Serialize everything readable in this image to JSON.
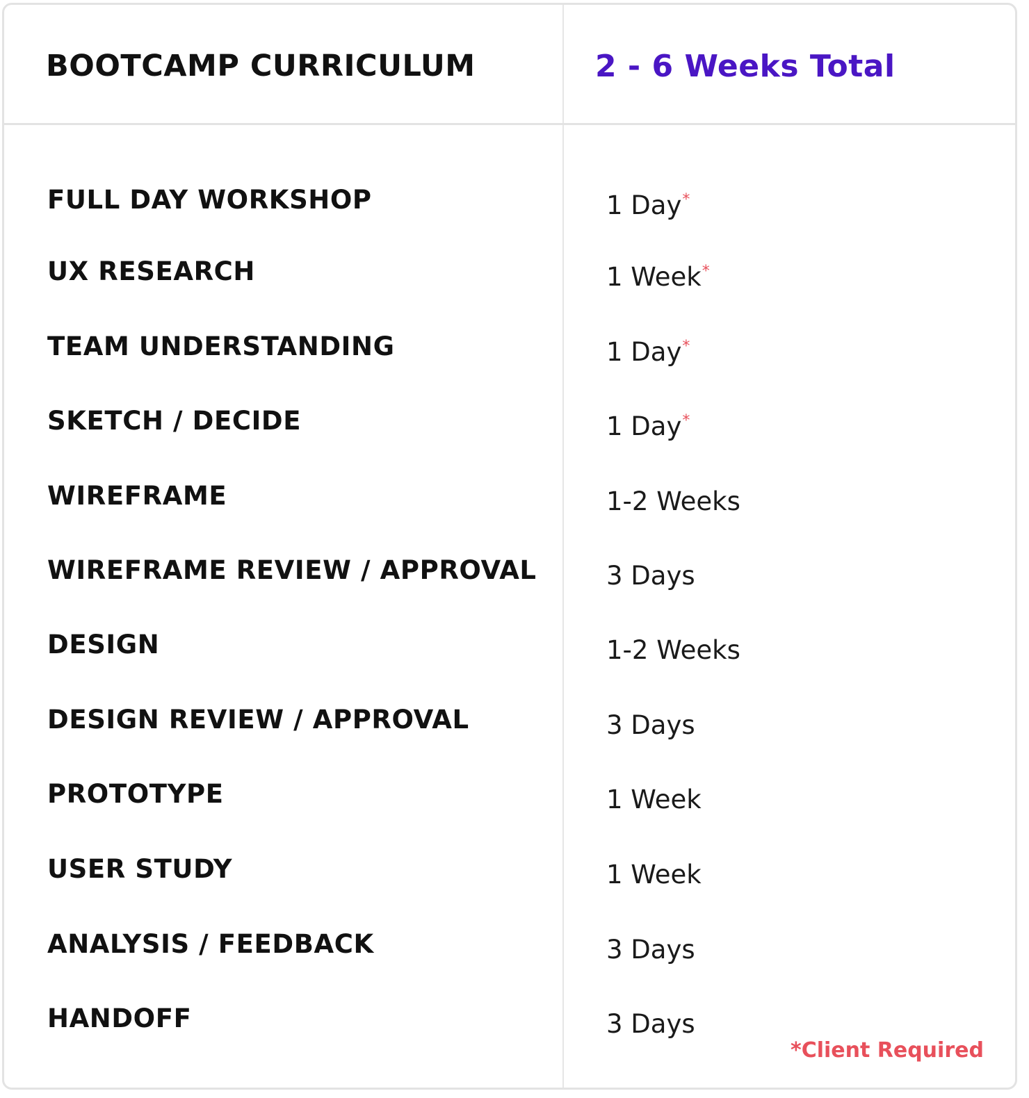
{
  "header": {
    "title": "BOOTCAMP CURRICULUM",
    "total": "2 - 6 Weeks Total"
  },
  "rows": [
    {
      "stage": "FULL DAY WORKSHOP",
      "duration": "1 Day",
      "required_mark": "*"
    },
    {
      "stage": "UX RESEARCH",
      "duration": "1 Week",
      "required_mark": "*"
    },
    {
      "stage": "TEAM UNDERSTANDING",
      "duration": "1 Day",
      "required_mark": "*"
    },
    {
      "stage": "SKETCH / DECIDE",
      "duration": "1 Day",
      "required_mark": "*"
    },
    {
      "stage": "WIREFRAME",
      "duration": "1-2 Weeks",
      "required_mark": ""
    },
    {
      "stage": "WIREFRAME REVIEW / APPROVAL",
      "duration": "3 Days",
      "required_mark": ""
    },
    {
      "stage": "DESIGN",
      "duration": "1-2 Weeks",
      "required_mark": ""
    },
    {
      "stage": "DESIGN REVIEW / APPROVAL",
      "duration": "3 Days",
      "required_mark": ""
    },
    {
      "stage": "PROTOTYPE",
      "duration": "1 Week",
      "required_mark": ""
    },
    {
      "stage": "USER STUDY",
      "duration": "1 Week",
      "required_mark": ""
    },
    {
      "stage": "ANALYSIS / FEEDBACK",
      "duration": "3 Days",
      "required_mark": ""
    },
    {
      "stage": "HANDOFF",
      "duration": "3 Days",
      "required_mark": ""
    }
  ],
  "footnote": "*Client Required",
  "colors": {
    "accent": "#4a16c4",
    "required": "#e8505b",
    "text": "#111111",
    "border": "#e3e3e3"
  }
}
